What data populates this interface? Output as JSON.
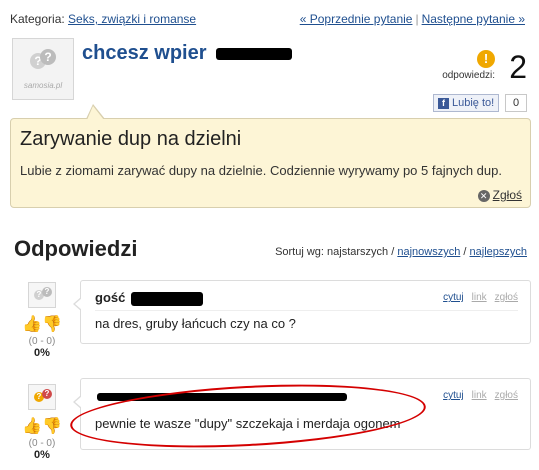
{
  "topbar": {
    "category_label": "Kategoria:",
    "category_link": "Seks, związki i romanse",
    "prev": "« Poprzednie pytanie",
    "separator": "|",
    "next": "Następne pytanie »"
  },
  "question": {
    "avatar_brand": "samosia.pl",
    "title": "chcesz wpier",
    "answers_label": "odpowiedzi:",
    "answers_count": "2",
    "like_label": "Lubię to!",
    "like_count": "0",
    "heading": "Zarywanie dup na dzielni",
    "body": "Lubie z ziomami zarywać dupy na dzielnie. Codziennie wyrywamy po 5 fajnych dup.",
    "report": "Zgłoś"
  },
  "answers_section": {
    "heading": "Odpowiedzi",
    "sort_label": "Sortuj wg: najstarszych /",
    "sort_newest": "najnowszych",
    "sort_sep": "/",
    "sort_best": "najlepszych"
  },
  "answers": [
    {
      "author": "gość",
      "text": "na dres, gruby łańcuch czy na co ?",
      "vote_range": "(0 - 0)",
      "vote_pct": "0%",
      "quote": "cytuj",
      "link": "link",
      "report": "zgłoś"
    },
    {
      "author": "",
      "text": "pewnie te wasze \"dupy\" szczekaja i merdaja ogonem",
      "vote_range": "(0 - 0)",
      "vote_pct": "0%",
      "quote": "cytuj",
      "link": "link",
      "report": "zgłoś"
    }
  ],
  "colors": {
    "link": "#1f4f8f",
    "question_box_bg": "#fdf5d6",
    "annotation_red": "#d40000",
    "thumb_up": "#c050b8",
    "thumb_down": "#e8b400"
  }
}
